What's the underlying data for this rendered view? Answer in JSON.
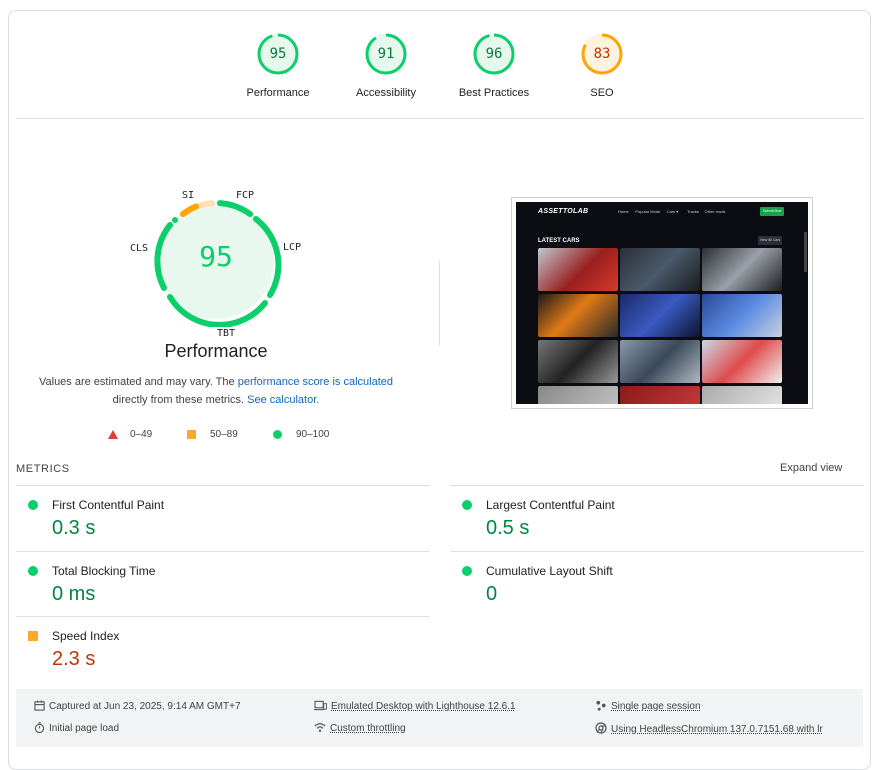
{
  "top_scores": [
    {
      "label": "Performance",
      "score": "95",
      "color": "#0cce6b",
      "text": "#087a3e"
    },
    {
      "label": "Accessibility",
      "score": "91",
      "color": "#0cce6b",
      "text": "#087a3e"
    },
    {
      "label": "Best Practices",
      "score": "96",
      "color": "#0cce6b",
      "text": "#087a3e"
    },
    {
      "label": "SEO",
      "score": "83",
      "color": "#ffa400",
      "text": "#c33300"
    }
  ],
  "perf": {
    "score": "95",
    "title": "Performance",
    "labels": {
      "si": "SI",
      "fcp": "FCP",
      "lcp": "LCP",
      "tbt": "TBT",
      "cls": "CLS"
    },
    "desc_prefix": "Values are estimated and may vary. The ",
    "desc_link1": "performance score is calculated",
    "desc_mid": "directly from these metrics. ",
    "desc_link2": "See calculator."
  },
  "legend": {
    "fail": "0–49",
    "average": "50–89",
    "pass": "90–100"
  },
  "metrics_section": {
    "title": "METRICS",
    "expand": "Expand view"
  },
  "metrics": [
    {
      "name": "First Contentful Paint",
      "value": "0.3 s",
      "status": "pass"
    },
    {
      "name": "Largest Contentful Paint",
      "value": "0.5 s",
      "status": "pass"
    },
    {
      "name": "Total Blocking Time",
      "value": "0 ms",
      "status": "pass"
    },
    {
      "name": "Cumulative Layout Shift",
      "value": "0",
      "status": "pass"
    },
    {
      "name": "Speed Index",
      "value": "2.3 s",
      "status": "average"
    }
  ],
  "footer": {
    "captured": "Captured at Jun 23, 2025, 9:14 AM GMT+7",
    "load": "Initial page load",
    "emulated": "Emulated Desktop with Lighthouse 12.6.1",
    "throttling": "Custom throttling",
    "session": "Single page session",
    "browser": "Using HeadlessChromium 137.0.7151.68 with lr"
  },
  "screenshot": {
    "logo": "ASSETTOLAB",
    "nav": [
      "Home",
      "Popular Mods",
      "Cars ▾",
      "Tracks",
      "Other mods"
    ],
    "cta": "Submit Mod",
    "heading": "LATEST CARS",
    "view_all": "View All Cars"
  },
  "colors": {
    "pass": "#0cce6b",
    "pass_text": "#018642",
    "average": "#ffa400",
    "average_text": "#c33300",
    "fail": "#ff4e42"
  }
}
